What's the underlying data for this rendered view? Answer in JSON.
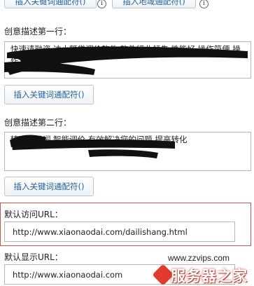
{
  "top_row": {
    "keyword_button": "插入关键词通配符()",
    "region_button": "插入地域通配符()",
    "info_icon": "i"
  },
  "line1": {
    "label": "创意描述第一行：",
    "value": "快速请融资,达小额贷调价软件,软件行业领先,性能好,操作简便,操作",
    "button": "插入关键词通配符()"
  },
  "line2": {
    "label": "创意描述第二行：",
    "value": "精选关键词,智能调价,有效解决您的问题,提高转化",
    "button": "插入关键词通配符()"
  },
  "visit_url": {
    "label": "默认访问URL：",
    "value": "http://www.xiaonaodai.com/dailishang.html"
  },
  "display_url": {
    "label": "默认显示URL：",
    "value": "http://www.xiaonaodai.com"
  },
  "watermark": {
    "url": "www.zzvips.com",
    "brand": "服务器之家"
  },
  "colors": {
    "link_blue": "#1f5fa8",
    "highlight_red": "#d9534f",
    "redaction": "#111111"
  }
}
